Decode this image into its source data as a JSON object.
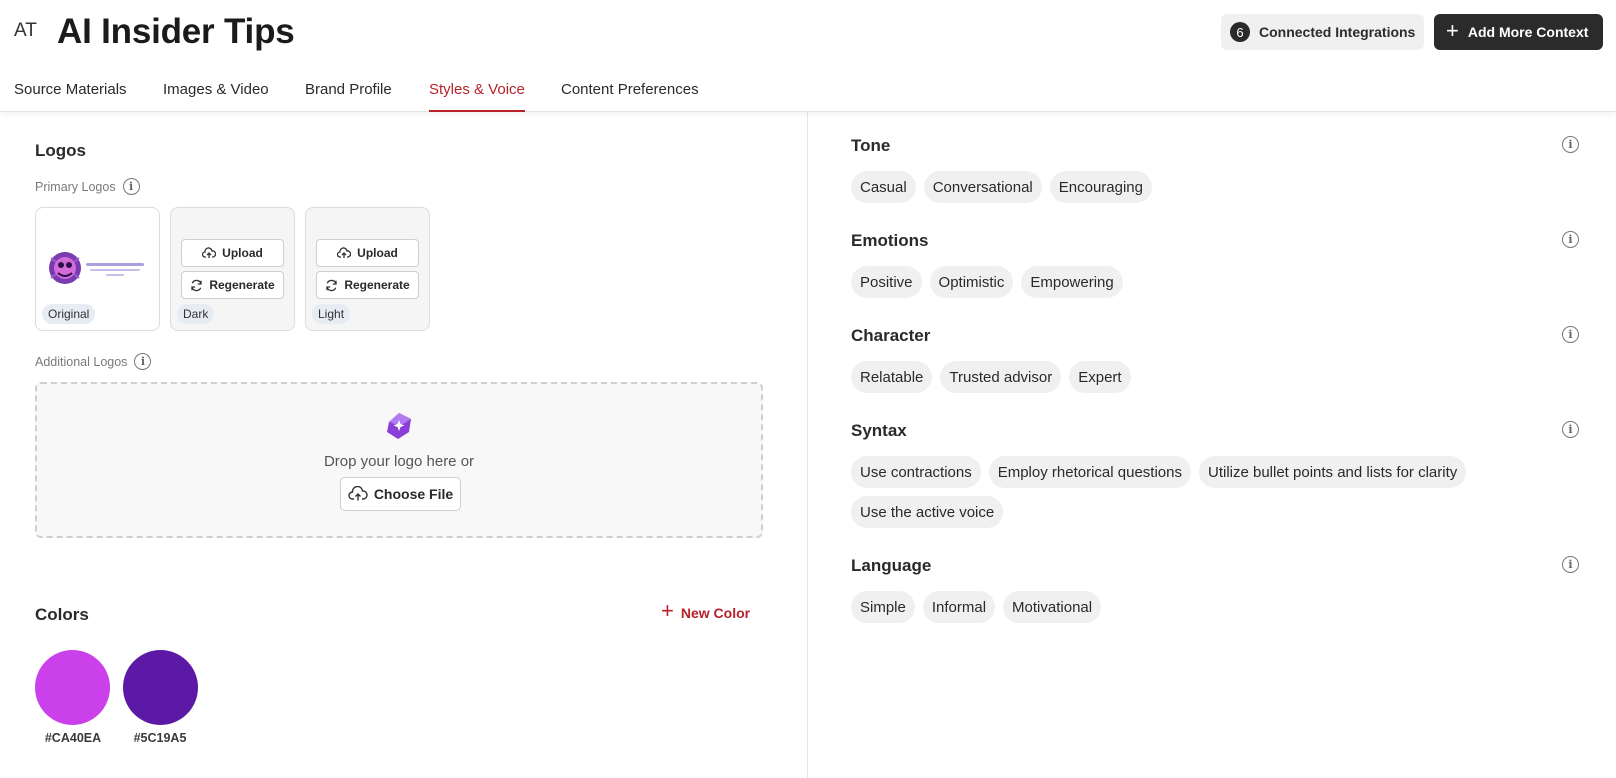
{
  "header": {
    "avatar": "AT",
    "title": "AI Insider Tips",
    "integrations": {
      "count": "6",
      "label": "Connected Integrations"
    },
    "add_context_label": "Add More Context"
  },
  "tabs": [
    {
      "label": "Source Materials"
    },
    {
      "label": "Images & Video"
    },
    {
      "label": "Brand Profile"
    },
    {
      "label": "Styles & Voice",
      "active": true
    },
    {
      "label": "Content Preferences"
    }
  ],
  "logos": {
    "title": "Logos",
    "primary_label": "Primary Logos",
    "cards": [
      {
        "tag": "Original"
      },
      {
        "tag": "Dark",
        "upload": "Upload",
        "regenerate": "Regenerate"
      },
      {
        "tag": "Light",
        "upload": "Upload",
        "regenerate": "Regenerate"
      }
    ],
    "additional_label": "Additional Logos",
    "drop_text": "Drop your logo here or",
    "choose_file": "Choose File"
  },
  "colors": {
    "title": "Colors",
    "new_color": "New Color",
    "swatches": [
      {
        "hex": "#CA40EA",
        "label": "#CA40EA"
      },
      {
        "hex": "#5C19A5",
        "label": "#5C19A5"
      }
    ]
  },
  "voice": {
    "tone": {
      "title": "Tone",
      "chips": [
        "Casual",
        "Conversational",
        "Encouraging"
      ]
    },
    "emotions": {
      "title": "Emotions",
      "chips": [
        "Positive",
        "Optimistic",
        "Empowering"
      ]
    },
    "character": {
      "title": "Character",
      "chips": [
        "Relatable",
        "Trusted advisor",
        "Expert"
      ]
    },
    "syntax": {
      "title": "Syntax",
      "chips": [
        "Use contractions",
        "Employ rhetorical questions",
        "Utilize bullet points and lists for clarity",
        "Use the active voice"
      ]
    },
    "language": {
      "title": "Language",
      "chips": [
        "Simple",
        "Informal",
        "Motivational"
      ]
    }
  },
  "theme": {
    "accent": "#b8222b",
    "dark_button": "#2b2b2b"
  }
}
